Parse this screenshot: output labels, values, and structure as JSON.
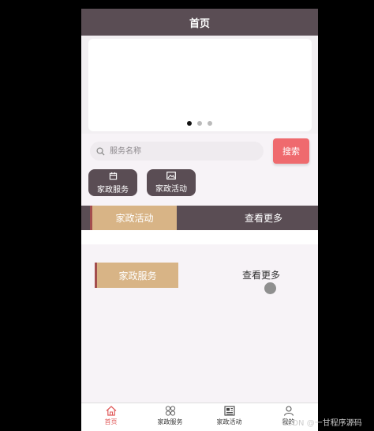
{
  "header": {
    "title": "首页"
  },
  "carousel": {
    "dots": 3,
    "active_index": 0
  },
  "search": {
    "placeholder": "服务名称",
    "button_label": "搜索"
  },
  "quick_links": [
    {
      "label": "家政服务",
      "icon": "calendar-icon"
    },
    {
      "label": "家政活动",
      "icon": "image-icon"
    }
  ],
  "sections": [
    {
      "title": "家政活动",
      "more_label": "查看更多"
    },
    {
      "title": "家政服务",
      "more_label": "查看更多"
    }
  ],
  "tabbar": [
    {
      "label": "首页",
      "icon": "home-icon",
      "active": true
    },
    {
      "label": "家政服务",
      "icon": "grid-icon",
      "active": false
    },
    {
      "label": "家政活动",
      "icon": "news-icon",
      "active": false
    },
    {
      "label": "我的",
      "icon": "user-icon",
      "active": false
    }
  ],
  "watermark": "CSDN @一甘程序源码",
  "colors": {
    "header": "#5a4d54",
    "accent_tag": "#d8b486",
    "tag_border": "#a34d4d",
    "search_button": "#ef6a6e",
    "active_tab": "#e05a5a"
  }
}
